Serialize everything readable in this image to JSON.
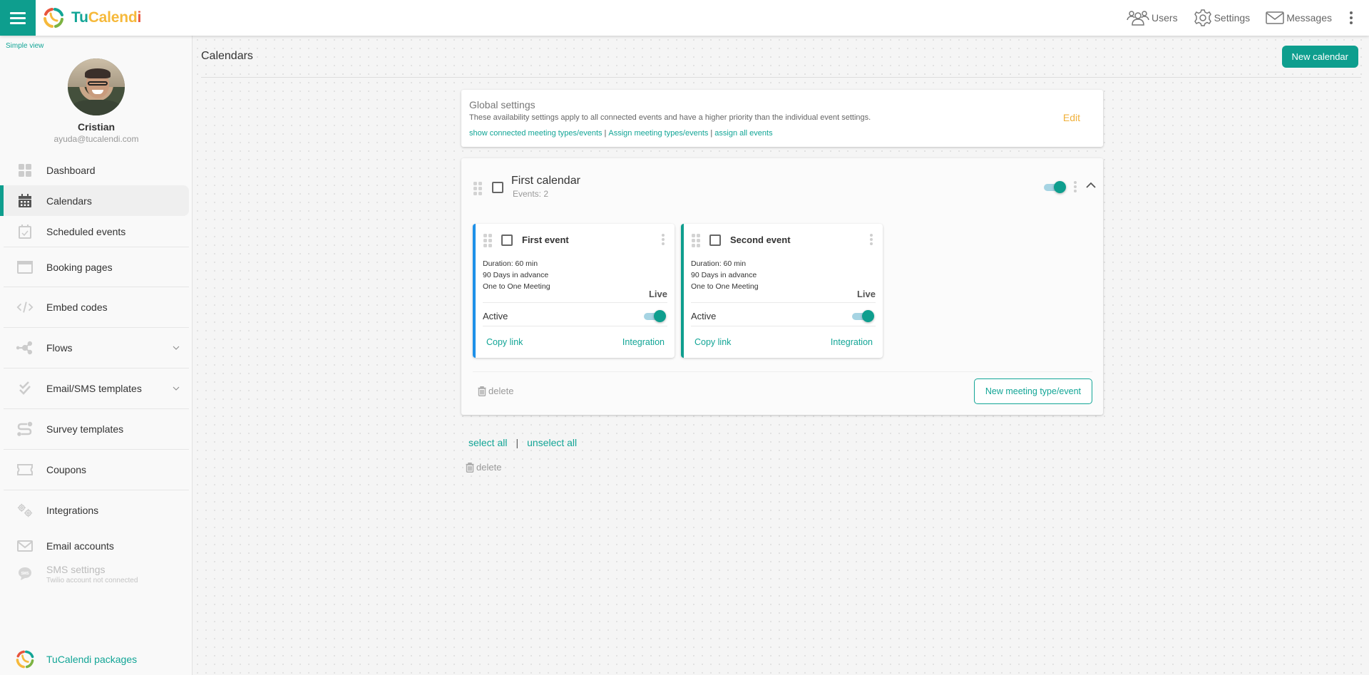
{
  "app": {
    "brand": {
      "part1": "Tu",
      "part2": "Calend",
      "part3": "i"
    },
    "colors": {
      "accent": "#0e9e8e",
      "link": "#12a596",
      "edit": "#f0b03a",
      "event1_bar": "#1e90e8",
      "event2_bar": "#0e9e8e"
    }
  },
  "topbar": {
    "links": [
      {
        "label": "Users",
        "icon": "users-icon"
      },
      {
        "label": "Settings",
        "icon": "gear-icon"
      },
      {
        "label": "Messages",
        "icon": "envelope-icon"
      }
    ]
  },
  "sidebar": {
    "simple_view": "Simple view",
    "user": {
      "name": "Cristian",
      "email": "ayuda@tucalendi.com"
    },
    "items": [
      {
        "label": "Dashboard",
        "icon": "dashboard-icon"
      },
      {
        "label": "Calendars",
        "icon": "calendar-icon",
        "active": true
      },
      {
        "label": "Scheduled events",
        "icon": "calendar-check-icon"
      },
      {
        "label": "Booking pages",
        "icon": "browser-window-icon"
      },
      {
        "label": "Embed codes",
        "icon": "code-icon"
      },
      {
        "label": "Flows",
        "icon": "flows-icon",
        "expandable": true
      },
      {
        "label": "Email/SMS templates",
        "icon": "double-check-icon",
        "expandable": true
      },
      {
        "label": "Survey templates",
        "icon": "survey-icon"
      },
      {
        "label": "Coupons",
        "icon": "coupon-icon"
      },
      {
        "label": "Integrations",
        "icon": "gears-icon"
      },
      {
        "label": "Email accounts",
        "icon": "envelope-icon"
      },
      {
        "label": "SMS settings",
        "sublabel": "Twilio account not connected",
        "icon": "sms-bubble-icon",
        "disabled": true
      }
    ],
    "packages": "TuCalendi packages"
  },
  "main": {
    "title": "Calendars",
    "new_calendar": "New calendar",
    "global_settings": {
      "title": "Global settings",
      "description": "These availability settings apply to all connected events and have a higher priority than the individual event settings.",
      "links": [
        "show connected meeting types/events",
        "Assign meeting types/events",
        "assign all events"
      ],
      "separator": "|",
      "edit": "Edit"
    },
    "calendar": {
      "name": "First calendar",
      "events_count": "Events: 2",
      "enabled": true,
      "events": [
        {
          "name": "First event",
          "duration": "Duration: 60 min",
          "advance": "90 Days in advance",
          "type": "One to One Meeting",
          "status": "Live",
          "active_label": "Active",
          "active": true,
          "copy_link": "Copy link",
          "integration": "Integration"
        },
        {
          "name": "Second event",
          "duration": "Duration: 60 min",
          "advance": "90 Days in advance",
          "type": "One to One Meeting",
          "status": "Live",
          "active_label": "Active",
          "active": true,
          "copy_link": "Copy link",
          "integration": "Integration"
        }
      ],
      "delete": "delete",
      "new_meeting": "New meeting type/event"
    },
    "select_all": "select all",
    "select_sep": "|",
    "unselect_all": "unselect all",
    "delete": "delete"
  }
}
